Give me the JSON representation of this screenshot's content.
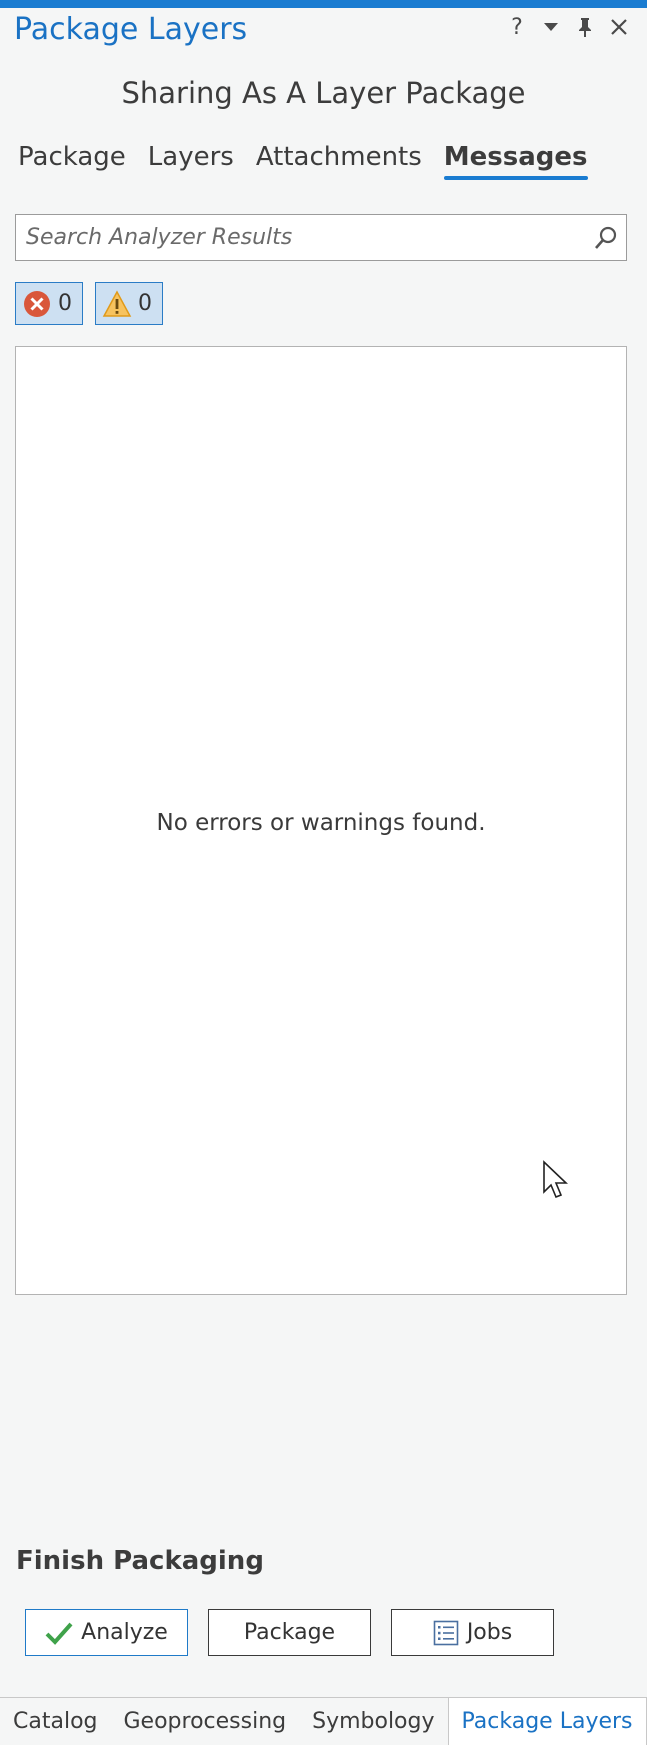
{
  "pane": {
    "title": "Package Layers",
    "controls": {
      "help": "?"
    }
  },
  "subtitle": "Sharing As A Layer Package",
  "tabs": [
    {
      "label": "Package",
      "active": false
    },
    {
      "label": "Layers",
      "active": false
    },
    {
      "label": "Attachments",
      "active": false
    },
    {
      "label": "Messages",
      "active": true
    }
  ],
  "search": {
    "placeholder": "Search Analyzer Results",
    "value": ""
  },
  "filters": {
    "errors": {
      "count": "0",
      "icon": "error-icon",
      "color": "#d9573b"
    },
    "warnings": {
      "count": "0",
      "icon": "warning-icon",
      "color": "#f0a21b"
    }
  },
  "results": {
    "empty_message": "No errors or warnings found."
  },
  "finish": {
    "title": "Finish Packaging",
    "buttons": {
      "analyze": {
        "label": "Analyze",
        "icon": "checkmark-icon"
      },
      "package": {
        "label": "Package"
      },
      "jobs": {
        "label": "Jobs",
        "icon": "list-icon"
      }
    }
  },
  "bottom_tabs": [
    {
      "label": "Catalog",
      "active": false
    },
    {
      "label": "Geoprocessing",
      "active": false
    },
    {
      "label": "Symbology",
      "active": false
    },
    {
      "label": "Package Layers",
      "active": true
    }
  ],
  "colors": {
    "accent": "#1a7cd1",
    "title": "#1a72c4",
    "filter_bg": "#cde0f2"
  }
}
